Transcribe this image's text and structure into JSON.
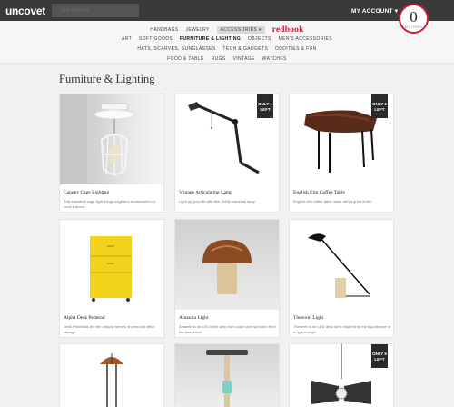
{
  "header": {
    "logo": "uncovet",
    "search_placeholder": "SEARCH",
    "account_label": "MY ACCOUNT ▾",
    "cart_count": "0",
    "cart_label": "MY ITEMS"
  },
  "nav": {
    "primary": [
      "HANDBAGS",
      "JEWELRY",
      "ACCESSORIES ▾"
    ],
    "brand": "redbook",
    "sub_row1": [
      "ART",
      "SOFT GOODS",
      "FURNITURE & LIGHTING",
      "OBJECTS",
      "MEN'S ACCESSORIES"
    ],
    "sub_row2": [
      "HATS, SCARVES, SUNGLASSES",
      "TECH & GADGETS",
      "ODDITIES & FUN"
    ],
    "sub_row3": [
      "FOOD & TABLE",
      "RUGS",
      "VINTAGE",
      "WATCHES"
    ]
  },
  "page_title": "Furniture & Lighting",
  "products": [
    {
      "name": "Canopy Cage Lighting",
      "desc": "This industrial cage light brings edge and excitement to a room's decor.",
      "badge": ""
    },
    {
      "name": "Vintage Articulating Lamp",
      "desc": "Light up your life with this 1940s industrial lamp.",
      "badge": "ONLY 1 LEFT"
    },
    {
      "name": "English Elm Coffee Table",
      "desc": "English elm coffee table made with a great finish.",
      "badge": "ONLY 1 LEFT"
    },
    {
      "name": "Alpha Desk Pedestal",
      "desc": "Desk Pedestals are the unsung heroes of personal office storage.",
      "badge": ""
    },
    {
      "name": "Amanita Light",
      "desc": "Amanita is an LED table lamp that could have sprouted from the forest floor.",
      "badge": ""
    },
    {
      "name": "Theorem Light",
      "desc": "Theorem is an LED desk lamp inspired by the hypotenuse of a right triangle.",
      "badge": ""
    },
    {
      "name": "",
      "desc": "",
      "badge": ""
    },
    {
      "name": "",
      "desc": "",
      "badge": ""
    },
    {
      "name": "",
      "desc": "",
      "badge": "ONLY 5 LEFT"
    }
  ]
}
